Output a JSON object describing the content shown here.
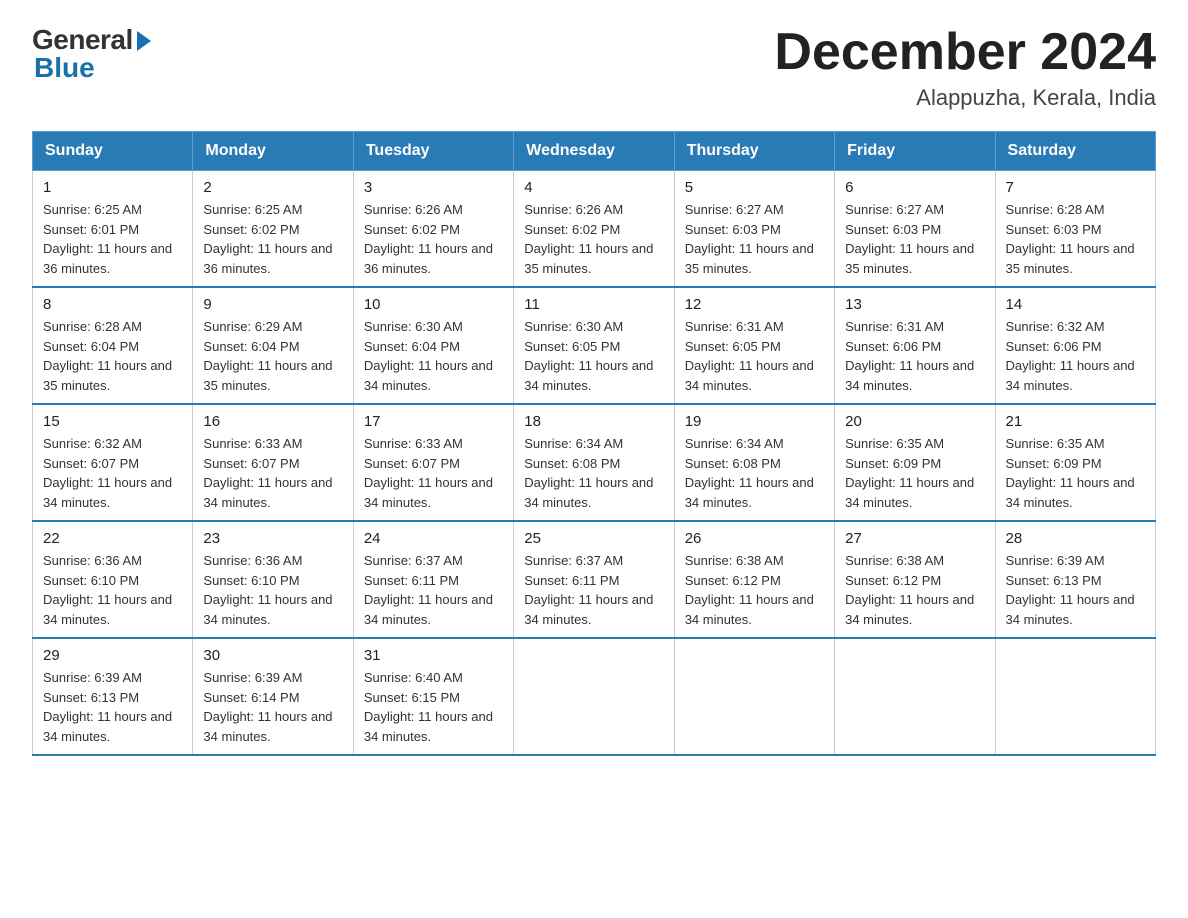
{
  "logo": {
    "general": "General",
    "blue": "Blue"
  },
  "title": "December 2024",
  "location": "Alappuzha, Kerala, India",
  "headers": [
    "Sunday",
    "Monday",
    "Tuesday",
    "Wednesday",
    "Thursday",
    "Friday",
    "Saturday"
  ],
  "weeks": [
    [
      {
        "day": "1",
        "sunrise": "6:25 AM",
        "sunset": "6:01 PM",
        "daylight": "11 hours and 36 minutes."
      },
      {
        "day": "2",
        "sunrise": "6:25 AM",
        "sunset": "6:02 PM",
        "daylight": "11 hours and 36 minutes."
      },
      {
        "day": "3",
        "sunrise": "6:26 AM",
        "sunset": "6:02 PM",
        "daylight": "11 hours and 36 minutes."
      },
      {
        "day": "4",
        "sunrise": "6:26 AM",
        "sunset": "6:02 PM",
        "daylight": "11 hours and 35 minutes."
      },
      {
        "day": "5",
        "sunrise": "6:27 AM",
        "sunset": "6:03 PM",
        "daylight": "11 hours and 35 minutes."
      },
      {
        "day": "6",
        "sunrise": "6:27 AM",
        "sunset": "6:03 PM",
        "daylight": "11 hours and 35 minutes."
      },
      {
        "day": "7",
        "sunrise": "6:28 AM",
        "sunset": "6:03 PM",
        "daylight": "11 hours and 35 minutes."
      }
    ],
    [
      {
        "day": "8",
        "sunrise": "6:28 AM",
        "sunset": "6:04 PM",
        "daylight": "11 hours and 35 minutes."
      },
      {
        "day": "9",
        "sunrise": "6:29 AM",
        "sunset": "6:04 PM",
        "daylight": "11 hours and 35 minutes."
      },
      {
        "day": "10",
        "sunrise": "6:30 AM",
        "sunset": "6:04 PM",
        "daylight": "11 hours and 34 minutes."
      },
      {
        "day": "11",
        "sunrise": "6:30 AM",
        "sunset": "6:05 PM",
        "daylight": "11 hours and 34 minutes."
      },
      {
        "day": "12",
        "sunrise": "6:31 AM",
        "sunset": "6:05 PM",
        "daylight": "11 hours and 34 minutes."
      },
      {
        "day": "13",
        "sunrise": "6:31 AM",
        "sunset": "6:06 PM",
        "daylight": "11 hours and 34 minutes."
      },
      {
        "day": "14",
        "sunrise": "6:32 AM",
        "sunset": "6:06 PM",
        "daylight": "11 hours and 34 minutes."
      }
    ],
    [
      {
        "day": "15",
        "sunrise": "6:32 AM",
        "sunset": "6:07 PM",
        "daylight": "11 hours and 34 minutes."
      },
      {
        "day": "16",
        "sunrise": "6:33 AM",
        "sunset": "6:07 PM",
        "daylight": "11 hours and 34 minutes."
      },
      {
        "day": "17",
        "sunrise": "6:33 AM",
        "sunset": "6:07 PM",
        "daylight": "11 hours and 34 minutes."
      },
      {
        "day": "18",
        "sunrise": "6:34 AM",
        "sunset": "6:08 PM",
        "daylight": "11 hours and 34 minutes."
      },
      {
        "day": "19",
        "sunrise": "6:34 AM",
        "sunset": "6:08 PM",
        "daylight": "11 hours and 34 minutes."
      },
      {
        "day": "20",
        "sunrise": "6:35 AM",
        "sunset": "6:09 PM",
        "daylight": "11 hours and 34 minutes."
      },
      {
        "day": "21",
        "sunrise": "6:35 AM",
        "sunset": "6:09 PM",
        "daylight": "11 hours and 34 minutes."
      }
    ],
    [
      {
        "day": "22",
        "sunrise": "6:36 AM",
        "sunset": "6:10 PM",
        "daylight": "11 hours and 34 minutes."
      },
      {
        "day": "23",
        "sunrise": "6:36 AM",
        "sunset": "6:10 PM",
        "daylight": "11 hours and 34 minutes."
      },
      {
        "day": "24",
        "sunrise": "6:37 AM",
        "sunset": "6:11 PM",
        "daylight": "11 hours and 34 minutes."
      },
      {
        "day": "25",
        "sunrise": "6:37 AM",
        "sunset": "6:11 PM",
        "daylight": "11 hours and 34 minutes."
      },
      {
        "day": "26",
        "sunrise": "6:38 AM",
        "sunset": "6:12 PM",
        "daylight": "11 hours and 34 minutes."
      },
      {
        "day": "27",
        "sunrise": "6:38 AM",
        "sunset": "6:12 PM",
        "daylight": "11 hours and 34 minutes."
      },
      {
        "day": "28",
        "sunrise": "6:39 AM",
        "sunset": "6:13 PM",
        "daylight": "11 hours and 34 minutes."
      }
    ],
    [
      {
        "day": "29",
        "sunrise": "6:39 AM",
        "sunset": "6:13 PM",
        "daylight": "11 hours and 34 minutes."
      },
      {
        "day": "30",
        "sunrise": "6:39 AM",
        "sunset": "6:14 PM",
        "daylight": "11 hours and 34 minutes."
      },
      {
        "day": "31",
        "sunrise": "6:40 AM",
        "sunset": "6:15 PM",
        "daylight": "11 hours and 34 minutes."
      },
      null,
      null,
      null,
      null
    ]
  ]
}
